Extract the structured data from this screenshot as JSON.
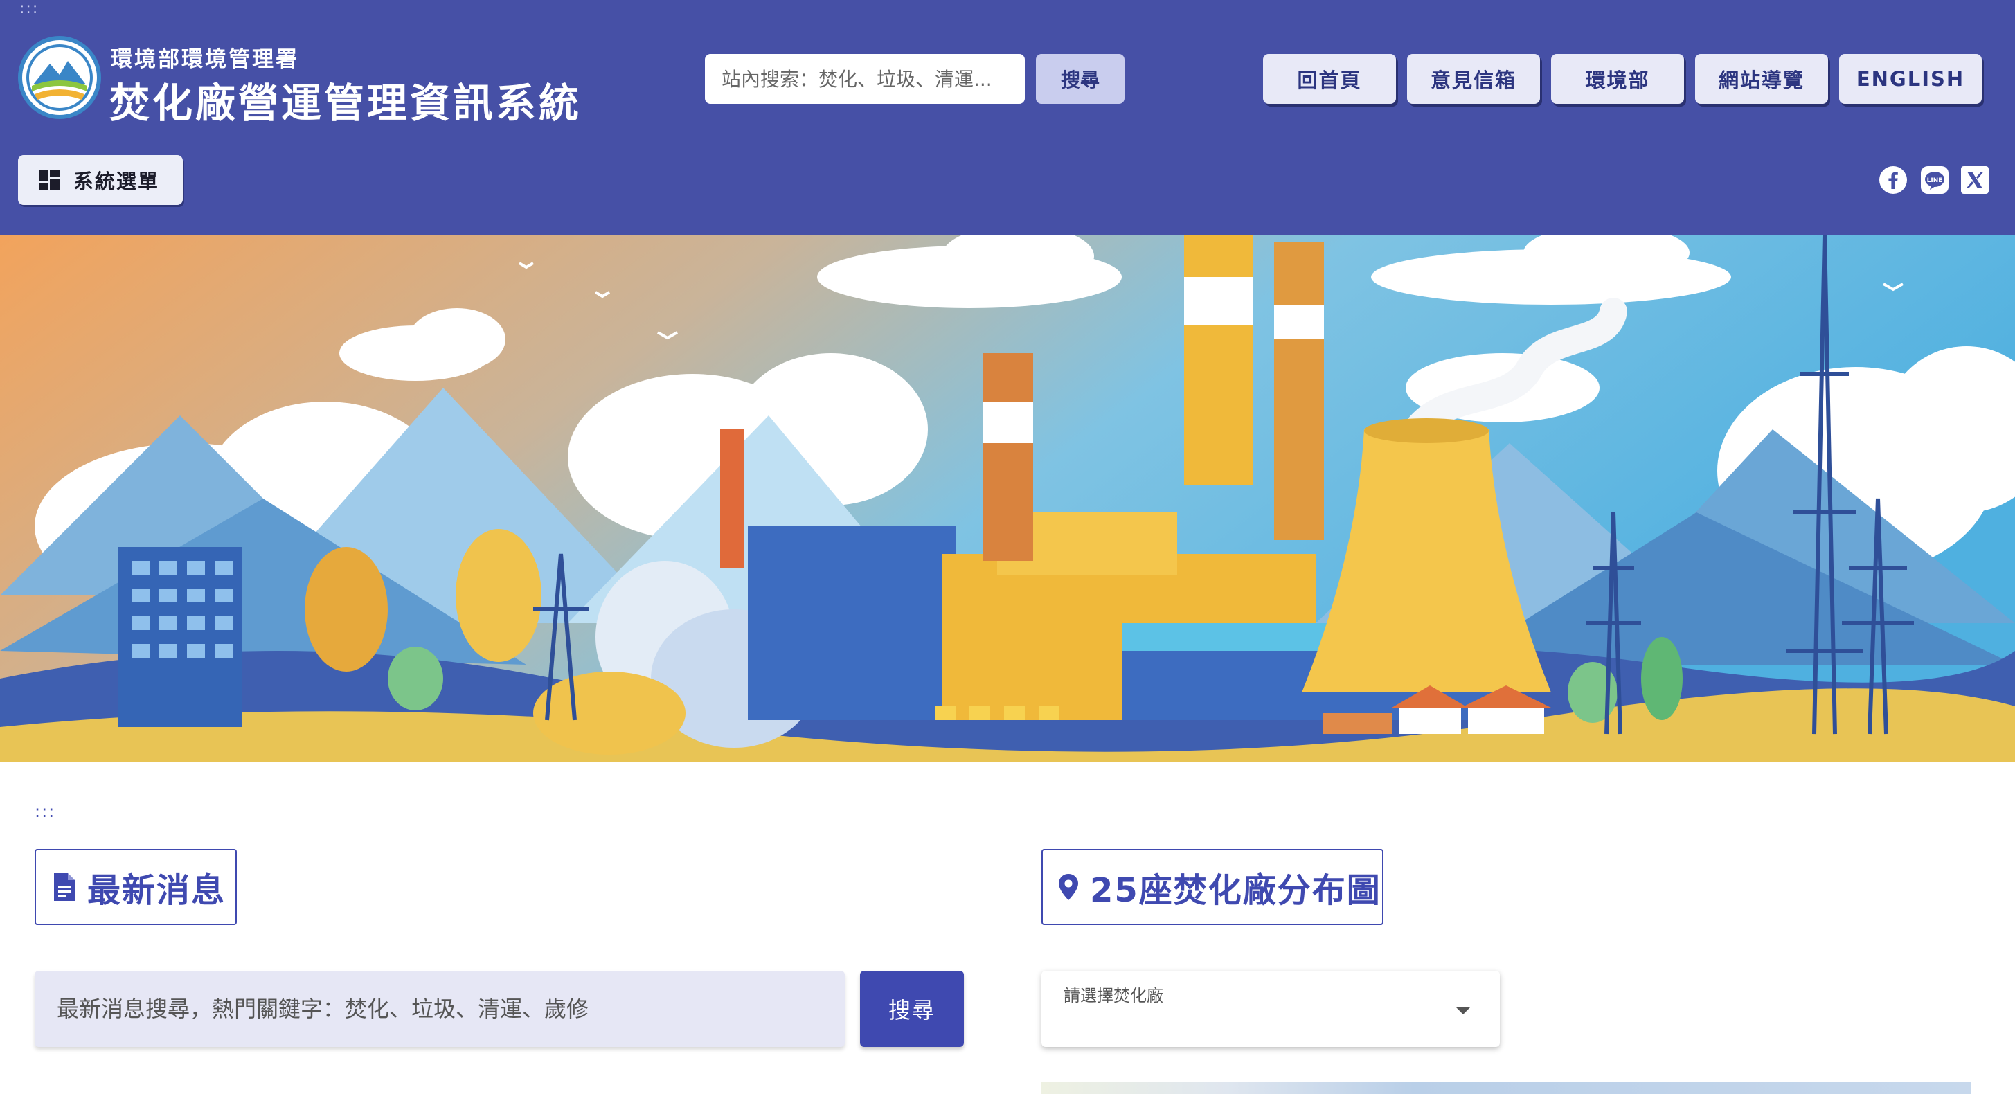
{
  "header": {
    "skip_link": ":::",
    "agency_name": "環境部環境管理署",
    "system_title": "焚化廠營運管理資訊系統",
    "site_search": {
      "placeholder": "站內搜索：焚化、垃圾、清運...",
      "button_label": "搜尋"
    },
    "nav": [
      {
        "label": "回首頁"
      },
      {
        "label": "意見信箱"
      },
      {
        "label": "環境部"
      },
      {
        "label": "網站導覽"
      },
      {
        "label": "ENGLISH"
      }
    ],
    "menu_button": {
      "label": "系統選單",
      "icon": "dashboard-grid-icon"
    },
    "social": [
      {
        "icon": "facebook-icon"
      },
      {
        "icon": "line-icon",
        "text": "LINE"
      },
      {
        "icon": "x-twitter-icon"
      }
    ],
    "colors": {
      "header_bg": "#4650a6",
      "accent": "#3f49b0"
    }
  },
  "banner": {
    "subject": "incineration-plant-illustration"
  },
  "main": {
    "skip_link": ":::",
    "news": {
      "title": "最新消息",
      "icon": "document-icon",
      "search_placeholder": "最新消息搜尋，熱門關鍵字：焚化、垃圾、清運、歲修",
      "search_button": "搜尋"
    },
    "map": {
      "title": "25座焚化廠分布圖",
      "icon": "location-pin-icon",
      "select_label": "請選擇焚化廠"
    }
  }
}
